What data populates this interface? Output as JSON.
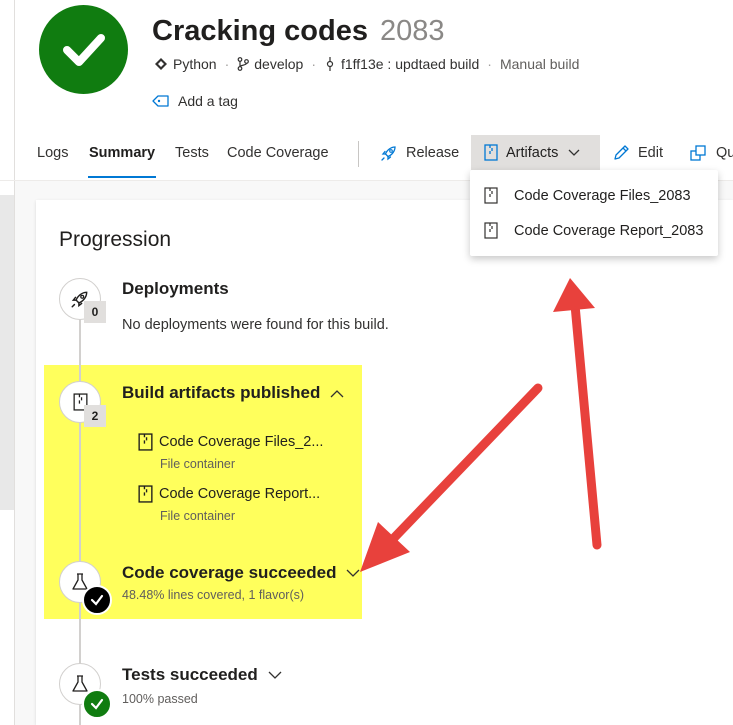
{
  "build": {
    "title": "Cracking codes",
    "number": "2083",
    "repo": "Python",
    "branch": "develop",
    "commit": "f1ff13e : updtaed build",
    "trigger": "Manual build",
    "add_tag": "Add a tag",
    "status_color": "#107c10"
  },
  "tabs": [
    "Logs",
    "Summary",
    "Tests",
    "Code Coverage"
  ],
  "toolbar": {
    "release": "Release",
    "artifacts": "Artifacts",
    "edit": "Edit",
    "queue": "Qu"
  },
  "artifacts_menu": [
    "Code Coverage Files_2083",
    "Code Coverage Report_2083"
  ],
  "progression": {
    "title": "Progression",
    "deployments": {
      "title": "Deployments",
      "count": "0",
      "message": "No deployments were found for this build."
    },
    "artifacts": {
      "title": "Build artifacts published",
      "count": "2",
      "items": [
        {
          "name": "Code Coverage Files_2...",
          "type": "File container"
        },
        {
          "name": "Code Coverage Report...",
          "type": "File container"
        }
      ]
    },
    "coverage": {
      "title": "Code coverage succeeded",
      "detail": "48.48% lines covered, 1 flavor(s)"
    },
    "tests": {
      "title": "Tests succeeded",
      "detail": "100% passed"
    }
  },
  "annotation": {
    "highlight_color": "#ffff40",
    "arrow_color": "#e8413c"
  }
}
